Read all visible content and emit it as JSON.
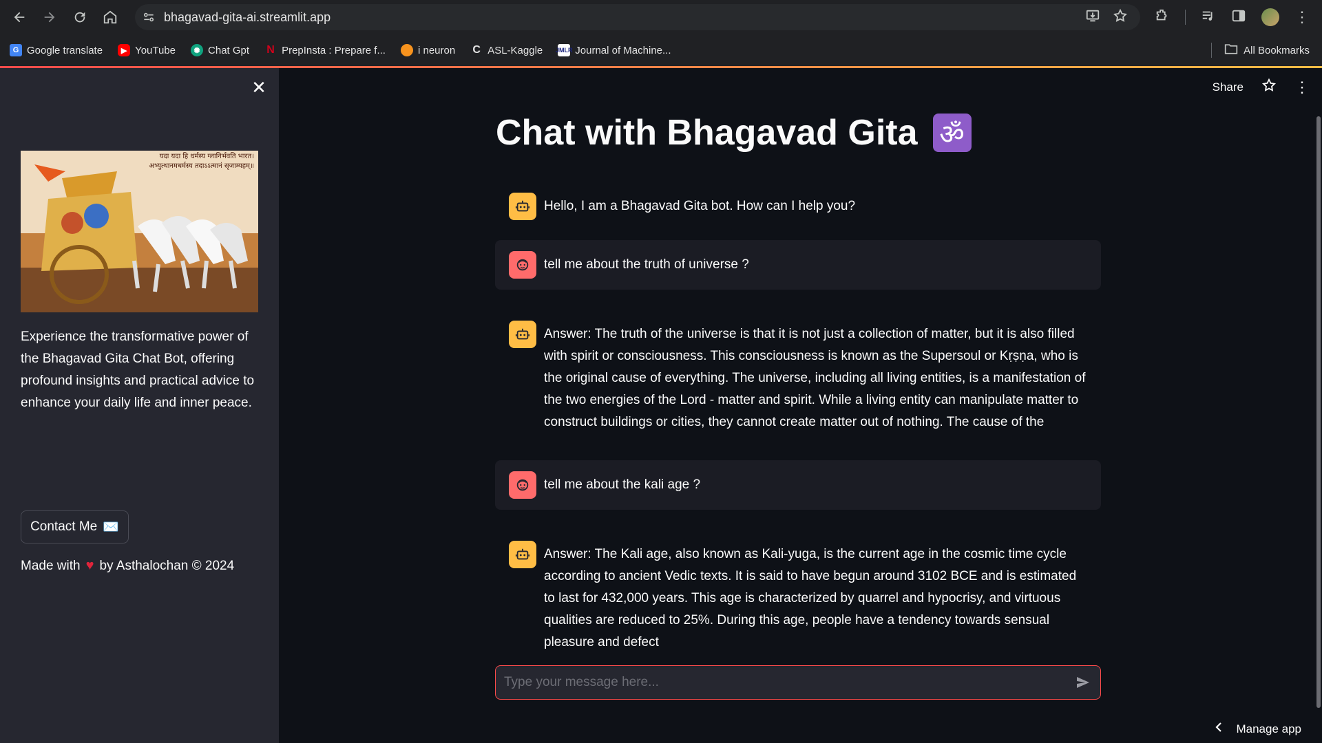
{
  "browser": {
    "url": "bhagavad-gita-ai.streamlit.app",
    "bookmarks": [
      {
        "label": "Google translate",
        "icon": "google-translate-icon",
        "color": "#4285f4"
      },
      {
        "label": "YouTube",
        "icon": "youtube-icon",
        "color": "#ff0000"
      },
      {
        "label": "Chat Gpt",
        "icon": "chatgpt-icon",
        "color": "#10a37f"
      },
      {
        "label": "PrepInsta : Prepare f...",
        "icon": "prepinsta-icon",
        "color": "#d0021b"
      },
      {
        "label": "i neuron",
        "icon": "ineuron-icon",
        "color": "#f7931e"
      },
      {
        "label": "ASL-Kaggle",
        "icon": "kaggle-icon",
        "color": "#e3e3e3"
      },
      {
        "label": "Journal of Machine...",
        "icon": "jmlr-icon",
        "color": "#ffffff"
      }
    ],
    "all_bookmarks": "All Bookmarks"
  },
  "sidebar": {
    "image_text": "यदा यदा हि धर्मस्य ग्लानिर्भवति भारत।\nअभ्युत्थानमधर्मस्य तदाऽऽत्मानं सृजाम्यहम्॥",
    "description": "Experience the transformative power of the Bhagavad Gita Chat Bot, offering profound insights and practical advice to enhance your daily life and inner peace.",
    "contact_label": "Contact Me",
    "contact_emoji": "✉️",
    "made_with_prefix": "Made with",
    "heart": "❤️",
    "made_with_suffix": "by Asthalochan © 2024"
  },
  "toolbar": {
    "share_label": "Share"
  },
  "main": {
    "title": "Chat with Bhagavad Gita",
    "title_emoji": "🕉️",
    "messages": [
      {
        "role": "assistant",
        "text": "Hello, I am a Bhagavad Gita bot. How can I help you?"
      },
      {
        "role": "user",
        "text": "tell me about the truth of universe ?"
      },
      {
        "role": "assistant",
        "text": "Answer: The truth of the universe is that it is not just a collection of matter, but it is also filled with spirit or consciousness. This consciousness is known as the Supersoul or Kṛṣṇa, who is the original cause of everything. The universe, including all living entities, is a manifestation of the two energies of the Lord - matter and spirit. While a living entity can manipulate matter to construct buildings or cities, they cannot create matter out of nothing. The cause of the"
      },
      {
        "role": "user",
        "text": "tell me about the kali age ?"
      },
      {
        "role": "assistant",
        "text": "Answer: The Kali age, also known as Kali-yuga, is the current age in the cosmic time cycle according to ancient Vedic texts. It is said to have begun around 3102 BCE and is estimated to last for 432,000 years. This age is characterized by quarrel and hypocrisy, and virtuous qualities are reduced to 25%. During this age, people have a tendency towards sensual pleasure and defect"
      }
    ],
    "input_placeholder": "Type your message here...",
    "input_value": ""
  },
  "manage_app": "Manage app",
  "colors": {
    "accent": "#ff4b4b",
    "bot_avatar": "#ffbd45",
    "user_avatar": "#ff6b6b",
    "sidebar_bg": "#262730",
    "main_bg": "#0e1117"
  }
}
